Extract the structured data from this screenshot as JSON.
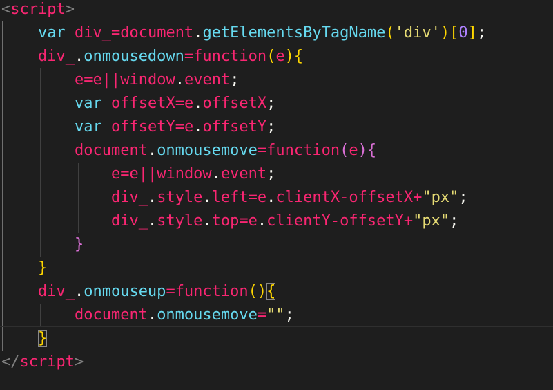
{
  "editor": {
    "language": "html",
    "lines": [
      [
        {
          "t": "<",
          "c": "tag"
        },
        {
          "t": "script",
          "c": "tagname"
        },
        {
          "t": ">",
          "c": "tag"
        }
      ],
      [
        {
          "t": "    ",
          "c": "plain"
        },
        {
          "t": "var",
          "c": "kw"
        },
        {
          "t": " ",
          "c": "plain"
        },
        {
          "t": "div_",
          "c": "var"
        },
        {
          "t": "=",
          "c": "op"
        },
        {
          "t": "document",
          "c": "var"
        },
        {
          "t": ".",
          "c": "punc"
        },
        {
          "t": "getElementsByTagName",
          "c": "fn"
        },
        {
          "t": "(",
          "c": "paren"
        },
        {
          "t": "'div'",
          "c": "str"
        },
        {
          "t": ")",
          "c": "paren"
        },
        {
          "t": "[",
          "c": "paren"
        },
        {
          "t": "0",
          "c": "num"
        },
        {
          "t": "]",
          "c": "paren"
        },
        {
          "t": ";",
          "c": "punc"
        }
      ],
      [
        {
          "t": "    ",
          "c": "plain"
        },
        {
          "t": "div_",
          "c": "var"
        },
        {
          "t": ".",
          "c": "punc"
        },
        {
          "t": "onmousedown",
          "c": "fn"
        },
        {
          "t": "=",
          "c": "op"
        },
        {
          "t": "function",
          "c": "var"
        },
        {
          "t": "(",
          "c": "paren"
        },
        {
          "t": "e",
          "c": "var"
        },
        {
          "t": ")",
          "c": "paren"
        },
        {
          "t": "{",
          "c": "brace-y"
        }
      ],
      [
        {
          "t": "        ",
          "c": "plain"
        },
        {
          "t": "e",
          "c": "var"
        },
        {
          "t": "=",
          "c": "op"
        },
        {
          "t": "e",
          "c": "var"
        },
        {
          "t": "||",
          "c": "op"
        },
        {
          "t": "window",
          "c": "var"
        },
        {
          "t": ".",
          "c": "punc"
        },
        {
          "t": "event",
          "c": "var"
        },
        {
          "t": ";",
          "c": "punc"
        }
      ],
      [
        {
          "t": "        ",
          "c": "plain"
        },
        {
          "t": "var",
          "c": "kw"
        },
        {
          "t": " ",
          "c": "plain"
        },
        {
          "t": "offsetX",
          "c": "var"
        },
        {
          "t": "=",
          "c": "op"
        },
        {
          "t": "e",
          "c": "var"
        },
        {
          "t": ".",
          "c": "punc"
        },
        {
          "t": "offsetX",
          "c": "var"
        },
        {
          "t": ";",
          "c": "punc"
        }
      ],
      [
        {
          "t": "        ",
          "c": "plain"
        },
        {
          "t": "var",
          "c": "kw"
        },
        {
          "t": " ",
          "c": "plain"
        },
        {
          "t": "offsetY",
          "c": "var"
        },
        {
          "t": "=",
          "c": "op"
        },
        {
          "t": "e",
          "c": "var"
        },
        {
          "t": ".",
          "c": "punc"
        },
        {
          "t": "offsetY",
          "c": "var"
        },
        {
          "t": ";",
          "c": "punc"
        }
      ],
      [
        {
          "t": "        ",
          "c": "plain"
        },
        {
          "t": "document",
          "c": "var"
        },
        {
          "t": ".",
          "c": "punc"
        },
        {
          "t": "onmousemove",
          "c": "fn"
        },
        {
          "t": "=",
          "c": "op"
        },
        {
          "t": "function",
          "c": "var"
        },
        {
          "t": "(",
          "c": "brace-p"
        },
        {
          "t": "e",
          "c": "var"
        },
        {
          "t": ")",
          "c": "brace-p"
        },
        {
          "t": "{",
          "c": "brace-p"
        }
      ],
      [
        {
          "t": "            ",
          "c": "plain"
        },
        {
          "t": "e",
          "c": "var"
        },
        {
          "t": "=",
          "c": "op"
        },
        {
          "t": "e",
          "c": "var"
        },
        {
          "t": "||",
          "c": "op"
        },
        {
          "t": "window",
          "c": "var"
        },
        {
          "t": ".",
          "c": "punc"
        },
        {
          "t": "event",
          "c": "var"
        },
        {
          "t": ";",
          "c": "punc"
        }
      ],
      [
        {
          "t": "            ",
          "c": "plain"
        },
        {
          "t": "div_",
          "c": "var"
        },
        {
          "t": ".",
          "c": "punc"
        },
        {
          "t": "style",
          "c": "var"
        },
        {
          "t": ".",
          "c": "punc"
        },
        {
          "t": "left",
          "c": "var"
        },
        {
          "t": "=",
          "c": "op"
        },
        {
          "t": "e",
          "c": "var"
        },
        {
          "t": ".",
          "c": "punc"
        },
        {
          "t": "clientX",
          "c": "var"
        },
        {
          "t": "-",
          "c": "op"
        },
        {
          "t": "offsetX",
          "c": "var"
        },
        {
          "t": "+",
          "c": "op"
        },
        {
          "t": "\"px\"",
          "c": "str"
        },
        {
          "t": ";",
          "c": "punc"
        }
      ],
      [
        {
          "t": "            ",
          "c": "plain"
        },
        {
          "t": "div_",
          "c": "var"
        },
        {
          "t": ".",
          "c": "punc"
        },
        {
          "t": "style",
          "c": "var"
        },
        {
          "t": ".",
          "c": "punc"
        },
        {
          "t": "top",
          "c": "var"
        },
        {
          "t": "=",
          "c": "op"
        },
        {
          "t": "e",
          "c": "var"
        },
        {
          "t": ".",
          "c": "punc"
        },
        {
          "t": "clientY",
          "c": "var"
        },
        {
          "t": "-",
          "c": "op"
        },
        {
          "t": "offsetY",
          "c": "var"
        },
        {
          "t": "+",
          "c": "op"
        },
        {
          "t": "\"px\"",
          "c": "str"
        },
        {
          "t": ";",
          "c": "punc"
        }
      ],
      [
        {
          "t": "        ",
          "c": "plain"
        },
        {
          "t": "}",
          "c": "brace-p"
        }
      ],
      [
        {
          "t": "    ",
          "c": "plain"
        },
        {
          "t": "}",
          "c": "brace-y"
        }
      ],
      [
        {
          "t": "    ",
          "c": "plain"
        },
        {
          "t": "div_",
          "c": "var"
        },
        {
          "t": ".",
          "c": "punc"
        },
        {
          "t": "onmouseup",
          "c": "fn"
        },
        {
          "t": "=",
          "c": "op"
        },
        {
          "t": "function",
          "c": "var"
        },
        {
          "t": "(",
          "c": "paren"
        },
        {
          "t": ")",
          "c": "paren"
        },
        {
          "t": "{",
          "c": "brace-y",
          "match": true
        }
      ],
      [
        {
          "t": "        ",
          "c": "plain"
        },
        {
          "t": "document",
          "c": "var"
        },
        {
          "t": ".",
          "c": "punc"
        },
        {
          "t": "onmousemove",
          "c": "fn"
        },
        {
          "t": "=",
          "c": "op"
        },
        {
          "t": "\"\"",
          "c": "str"
        },
        {
          "t": ";",
          "c": "punc"
        }
      ],
      [
        {
          "t": "    ",
          "c": "plain"
        },
        {
          "t": "}",
          "c": "brace-y",
          "match": true
        }
      ],
      [
        {
          "t": "</",
          "c": "tag"
        },
        {
          "t": "script",
          "c": "tagname"
        },
        {
          "t": ">",
          "c": "tag"
        }
      ]
    ],
    "current_line": 13
  }
}
